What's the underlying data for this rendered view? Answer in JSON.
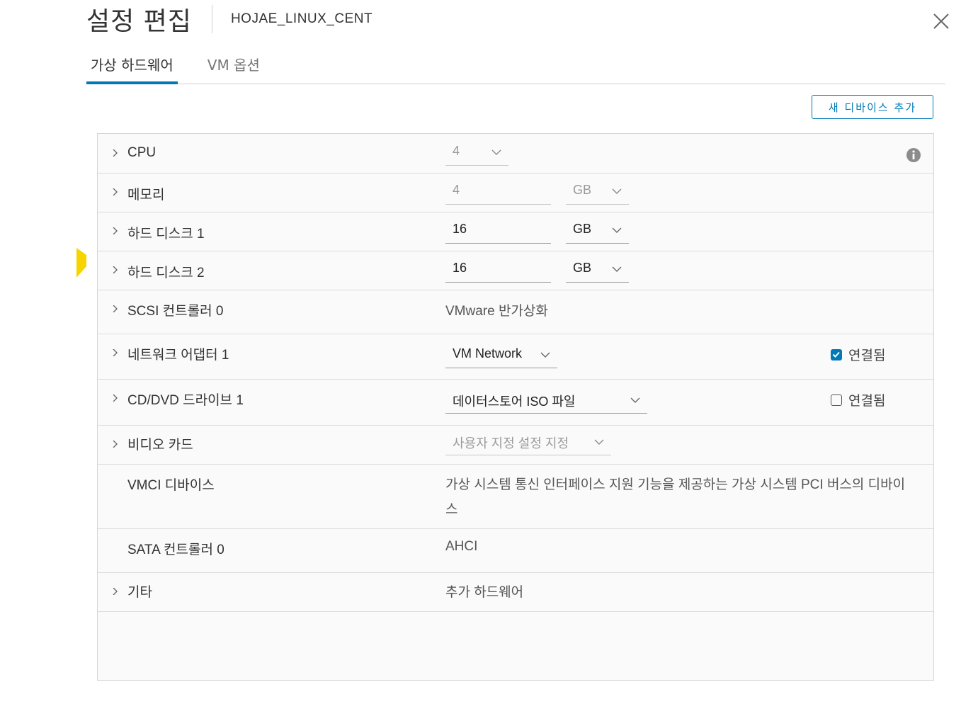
{
  "dialog": {
    "title": "설정 편집",
    "vm_name": "HOJAE_LINUX_CENT"
  },
  "tabs": [
    {
      "label": "가상 하드웨어",
      "active": true
    },
    {
      "label": "VM 옵션",
      "active": false
    }
  ],
  "toolbar": {
    "add_device_label": "새 디바이스 추가"
  },
  "hardware": {
    "cpu": {
      "label": "CPU",
      "value": "4"
    },
    "memory": {
      "label": "메모리",
      "value": "4",
      "unit": "GB"
    },
    "disk1": {
      "label": "하드 디스크 1",
      "value": "16",
      "unit": "GB"
    },
    "disk2": {
      "label": "하드 디스크 2",
      "value": "16",
      "unit": "GB"
    },
    "scsi": {
      "label": "SCSI 컨트롤러 0",
      "value": "VMware 반가상화"
    },
    "network": {
      "label": "네트워크 어댑터 1",
      "value": "VM Network",
      "connected_label": "연결됨",
      "connected": true
    },
    "cdrom": {
      "label": "CD/DVD 드라이브 1",
      "value": "데이터스토어 ISO 파일",
      "connected_label": "연결됨",
      "connected": false
    },
    "video": {
      "label": "비디오 카드",
      "value": "사용자 지정 설정 지정"
    },
    "vmci": {
      "label": "VMCI 디바이스",
      "value": "가상 시스템 통신 인터페이스 지원 기능을 제공하는 가상 시스템 PCI 버스의 디바이스"
    },
    "sata": {
      "label": "SATA 컨트롤러 0",
      "value": "AHCI"
    },
    "other": {
      "label": "기타",
      "value": "추가 하드웨어"
    }
  },
  "colors": {
    "accent": "#0079b8",
    "yellow_marker": "#f5d400"
  }
}
